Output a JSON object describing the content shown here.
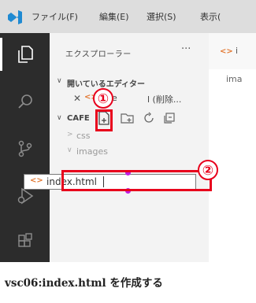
{
  "menubar": {
    "items": [
      "ファイル(F)",
      "編集(E)",
      "選択(S)",
      "表示("
    ]
  },
  "activitybar": {
    "icons": [
      "explorer-icon",
      "search-icon",
      "source-control-icon",
      "run-debug-icon",
      "extensions-icon"
    ]
  },
  "sidebar": {
    "title": "エクスプローラー",
    "more": "···",
    "open_editors_label": "開いているエディター",
    "open_editor_item": "index.html (削除...",
    "open_editor_item_prefix": "inde",
    "open_editor_item_suffix": "l (削除...",
    "folder_label": "CAFE",
    "tree": [
      {
        "label": "css",
        "chevron": ">"
      },
      {
        "label": "images",
        "chevron": "∨"
      }
    ],
    "rename_value": "index.html",
    "rename_icon": "<>"
  },
  "editor": {
    "tab_icon": "<>",
    "tab_label": "i",
    "line_text": "ima"
  },
  "annotations": {
    "badge1": "①",
    "badge2": "②"
  },
  "caption": "vsc06:index.html を作成する",
  "colors": {
    "annotation_red": "#e8001c",
    "activitybar": "#2c2c2c",
    "sidebar_bg": "#f3f3f3",
    "accent_orange": "#e37933"
  }
}
